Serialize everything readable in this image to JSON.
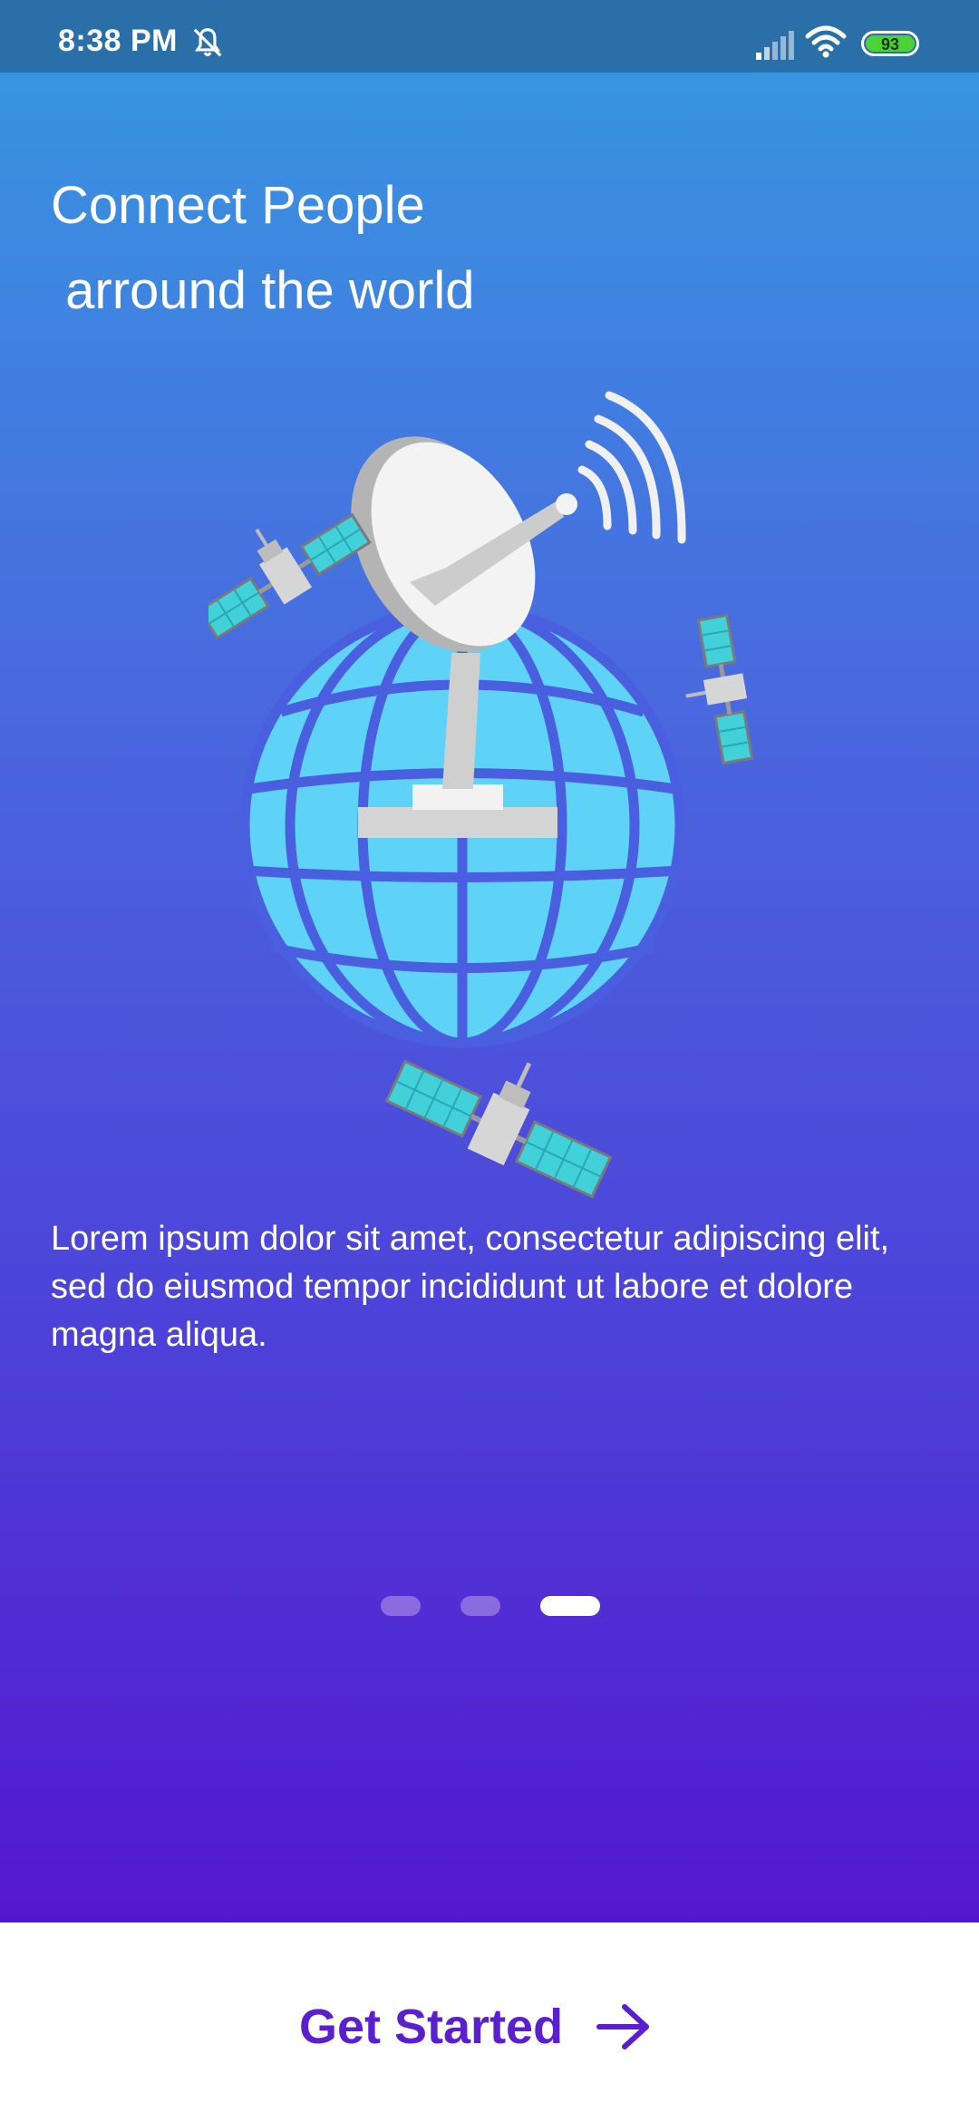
{
  "status_bar": {
    "time": "8:38 PM",
    "battery_level": "93",
    "icons": [
      "mute-icon",
      "signal-icon",
      "wifi-icon",
      "battery-icon"
    ]
  },
  "onboarding": {
    "title": "Connect People\n arround the world",
    "description": "Lorem ipsum dolor sit amet, consectetur adipiscing elit, sed do eiusmod tempor incididunt ut labore et dolore magna aliqua.",
    "page_indicator": {
      "total": 3,
      "current": 3
    }
  },
  "footer": {
    "cta_label": "Get Started",
    "cta_icon": "arrow-right-icon"
  },
  "colors": {
    "status_bar": "#2a6fa8",
    "gradient_top": "#3894e0",
    "gradient_bottom": "#5417cf",
    "accent": "#5a1fcf",
    "globe": "#5fd3f7",
    "solar_panel": "#42d1d8"
  }
}
